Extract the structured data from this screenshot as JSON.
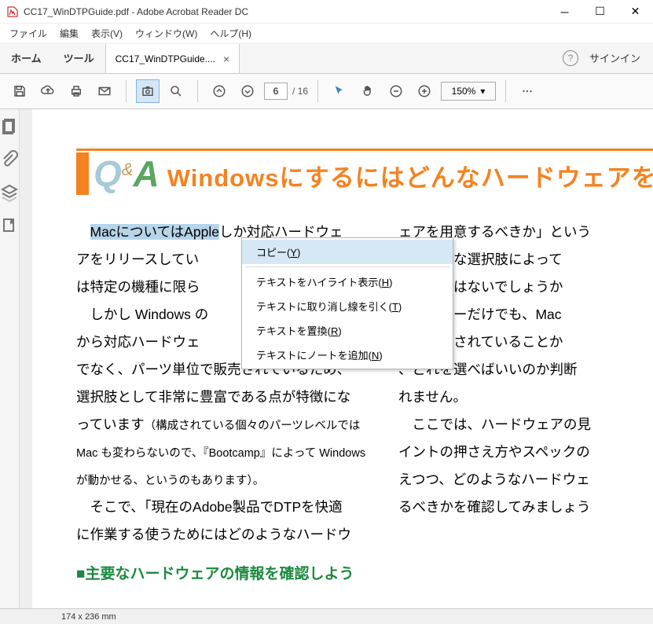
{
  "window": {
    "title": "CC17_WinDTPGuide.pdf - Adobe Acrobat Reader DC"
  },
  "menubar": {
    "items": [
      "ファイル",
      "編集",
      "表示(V)",
      "ウィンドウ(W)",
      "ヘルプ(H)"
    ]
  },
  "tabbar": {
    "home": "ホーム",
    "tools": "ツール",
    "doc_tab": "CC17_WinDTPGuide....",
    "signin": "サインイン"
  },
  "toolbar": {
    "page_current": "6",
    "page_total": "/ 16",
    "zoom": "150%"
  },
  "document": {
    "heading": "Windowsにするにはどんなハードウェアを選ぶ",
    "selected_text": "MacについてはApple",
    "col1_lines": [
      "しか対応ハードウェ",
      "アをリリースしてい",
      "は特定の機種に限ら",
      "　しかし Windows の",
      "から対応ハードウェ",
      "でなく、パーツ単位で販売されているため、",
      "選択肢として非常に豊富である点が特徴にな",
      "っています"
    ],
    "col1_small": "（構成されている個々のパーツレベルでは Mac も変わらないので、『Bootcamp』によって Windows が動かせる、というのもあります）。",
    "col1_tail": [
      "　そこで、「現在のAdobe製品でDTPを快適",
      "に作業する使うためにはどのようなハードウ"
    ],
    "col2_lines": [
      "ェアを用意するべきか」という",
      "その豊富な選択肢によって",
      "なるのではないでしょうか",
      "のメーカーだけでも、Mac",
      "プが用意されていることか",
      "、どれを選べばいいのか判断",
      "れません。",
      "　ここでは、ハードウェアの見",
      "イントの押さえ方やスペックの",
      "えつつ、どのようなハードウェ",
      "るべきかを確認してみましょう"
    ],
    "subheading": "■主要なハードウェアの情報を確認しよう"
  },
  "context_menu": {
    "items": [
      {
        "label": "コピー",
        "shortcut": "Y",
        "hover": true
      },
      {
        "sep": true
      },
      {
        "label": "テキストをハイライト表示",
        "shortcut": "H"
      },
      {
        "label": "テキストに取り消し線を引く",
        "shortcut": "T"
      },
      {
        "label": "テキストを置換",
        "shortcut": "R"
      },
      {
        "label": "テキストにノートを追加",
        "shortcut": "N"
      }
    ]
  },
  "statusbar": {
    "dims": "174 x 236 mm"
  }
}
